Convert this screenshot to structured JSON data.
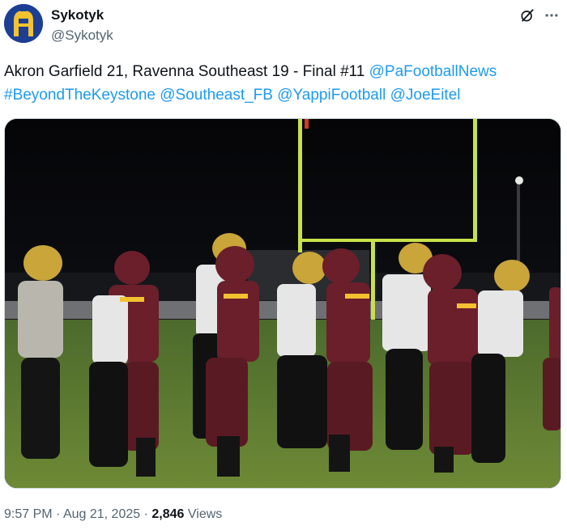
{
  "author": {
    "display_name": "Sykotyk",
    "handle": "@Sykotyk",
    "avatar_icon": "spartan-helmet-avatar-icon"
  },
  "tweet": {
    "text_plain": "Akron Garfield 21, Ravenna Southeast 19 - Final #11 ",
    "mentions": {
      "pafootballnews": "@PaFootballNews",
      "beyondthekeystone": "#BeyondTheKeystone",
      "southeast_fb": "@Southeast_FB",
      "yappifootball": "@YappiFootball",
      "joeeitel": "@JoeEitel"
    }
  },
  "meta": {
    "time": "9:57 PM",
    "separator": "·",
    "date": "Aug 21, 2025",
    "views_count": "2,846",
    "views_label": "Views"
  },
  "icons": {
    "grok": "grok-icon",
    "more": "more-dots-icon"
  },
  "colors": {
    "link": "#1d9bf0",
    "text": "#0f1419",
    "secondary": "#536471",
    "maroon": "#6a1f2b",
    "gold": "#f2c230",
    "helmet_gold": "#c9a53a"
  }
}
